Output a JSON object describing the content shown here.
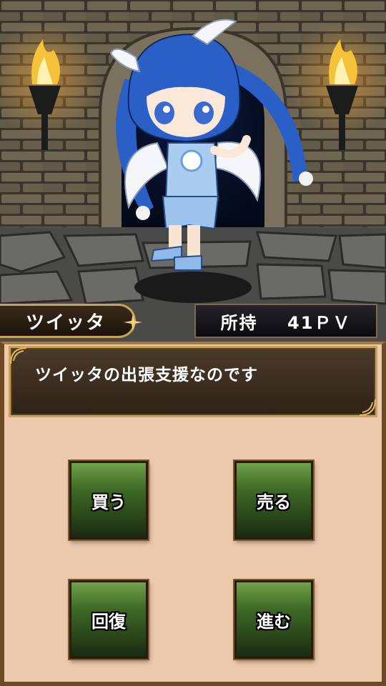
{
  "character": {
    "name": "ツイッタ"
  },
  "status": {
    "label": "所持",
    "value": "41ＰＶ"
  },
  "message": {
    "text": "ツイッタの出張支援なのです"
  },
  "menu": {
    "buy_label": "買う",
    "sell_label": "売る",
    "heal_label": "回復",
    "proceed_label": "進む"
  }
}
